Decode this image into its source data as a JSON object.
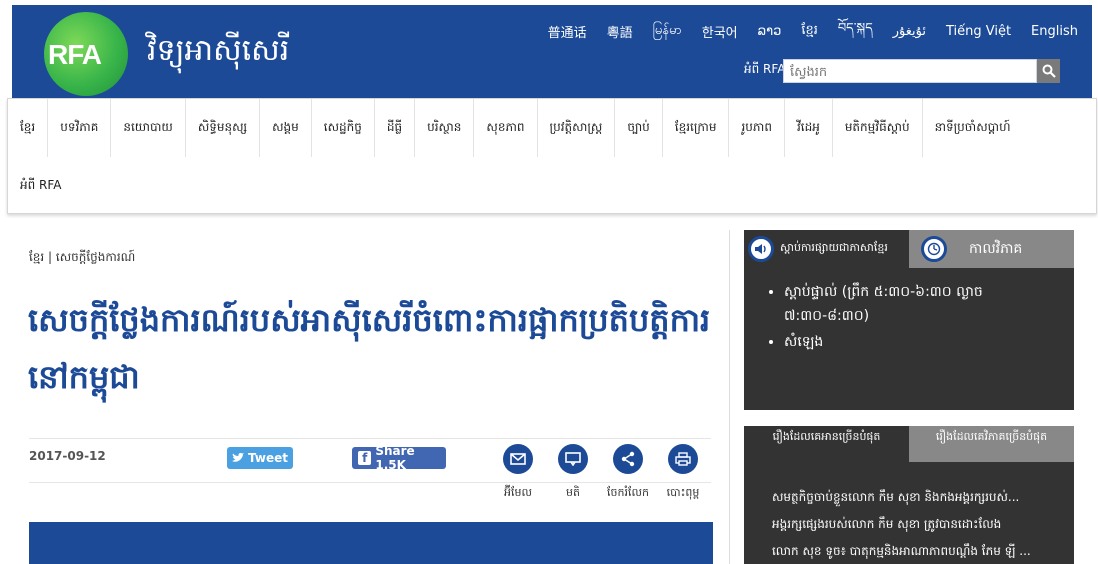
{
  "header": {
    "logo_text": "RFA",
    "site_title": "វិទ្យុអាស៊ីសេរី",
    "languages": [
      "普通话",
      "粵語",
      "မြန်မာ",
      "한국어",
      "ລາວ",
      "ខ្មែរ",
      "བོད་སྐད",
      "ئۇيغۇر",
      "Tiếng Việt",
      "English"
    ],
    "about_label": "អំពី RFA",
    "search_placeholder": "ស្វែងរក"
  },
  "nav": {
    "row1": [
      "ខ្មែរ",
      "បទវិភាគ",
      "នយោបាយ",
      "សិទ្ធិមនុស្ស",
      "សង្គម",
      "សេដ្ឋកិច្ច",
      "ដីធ្លី",
      "បរិស្ថាន",
      "សុខភាព",
      "ប្រវត្តិសាស្ត្រ",
      "ច្បាប់",
      "ខ្មែរក្រោម",
      "រូបភាព",
      "វីដេអូ",
      "មតិកម្មវិធីស្តាប់",
      "នាទីប្រចាំសប្តាហ៍"
    ],
    "row2": [
      "អំពី RFA"
    ]
  },
  "article": {
    "breadcrumb": "ខ្មែរ | សេចក្តីថ្លែងការណ៍",
    "headline": "សេចក្តីថ្លែងការណ៍របស់អាស៊ីសេរីចំពោះការផ្អាកប្រតិបត្តិការនៅកម្ពុជា",
    "date": "2017-09-12",
    "tweet_label": "Tweet",
    "fb_label": "Share 1.5K",
    "share_actions": [
      "អ៊ីមែល",
      "មតិ",
      "ចែករំលែក",
      "បោះពុម្ព"
    ]
  },
  "sidebar": {
    "listen_tab": "ស្តាប់ការផ្សាយជាភាសាខ្មែរ",
    "schedule_tab": "កាលវិភាគ",
    "listen_items": [
      "ស្តាប់ផ្ទាល់ (ព្រឹក ៥:៣០-៦:៣០ ល្ងាច ៧:៣០-៨:៣០)",
      "សំឡេង"
    ],
    "popular_tab_a": "រឿងដែលគេអានច្រើនបំផុត",
    "popular_tab_b": "រឿងដែលគេវិភាគច្រើនបំផុត",
    "popular_items": [
      "សមត្ថកិច្ចចាប់ខ្លួនលោក កឹម សុខា និងកងអង្គរក្សរបស់...",
      "អង្គរក្សផ្សេងរបស់លោក កឹម សុខា ត្រូវបានដោះលែង",
      "លោក សុខ ទូច៖ បាតុកម្មនិងអាណាភាពបណ្តឹង ភែម ឡី ..."
    ]
  }
}
